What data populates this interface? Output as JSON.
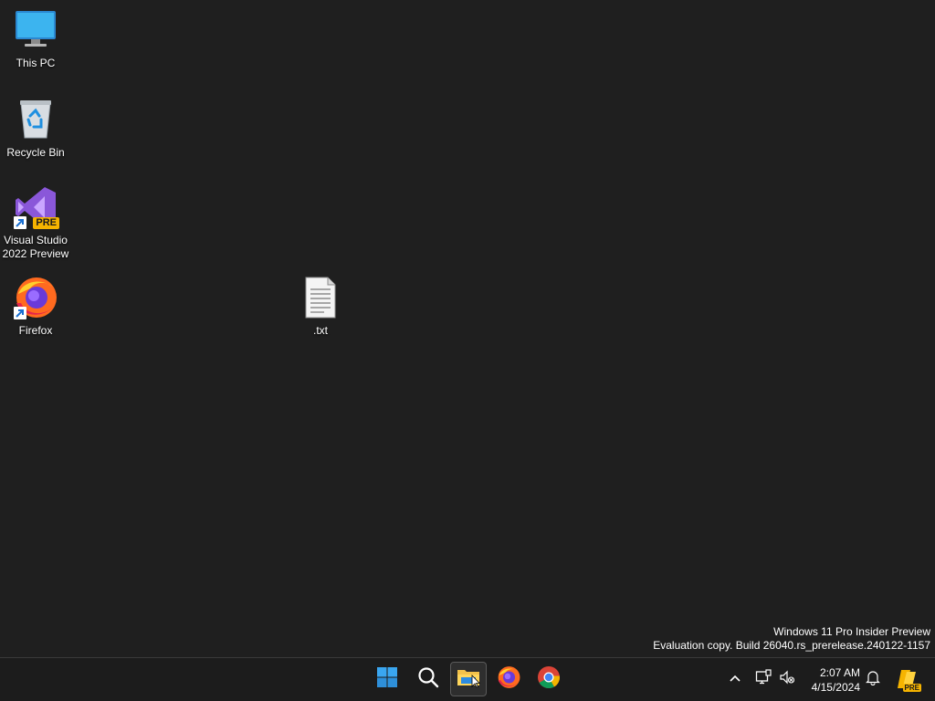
{
  "desktop": {
    "icons": [
      {
        "label": "This PC",
        "icon": "monitor-icon"
      },
      {
        "label": "Recycle Bin",
        "icon": "recycle-bin-icon"
      },
      {
        "label_line1": "Visual Studio",
        "label_line2": "2022 Preview",
        "icon": "visual-studio-icon",
        "badge": "PRE"
      },
      {
        "label": "Firefox",
        "icon": "firefox-icon"
      },
      {
        "label": ".txt",
        "icon": "text-file-icon"
      }
    ]
  },
  "watermark": {
    "line1": "Windows 11 Pro Insider Preview",
    "line2": "Evaluation copy. Build 26040.rs_prerelease.240122-1157"
  },
  "taskbar": {
    "apps": [
      "start-icon",
      "search-icon",
      "file-explorer-icon",
      "firefox-icon",
      "chrome-icon"
    ],
    "active_app": "file-explorer-icon",
    "clock": {
      "time": "2:07 AM",
      "date": "4/15/2024"
    },
    "tray_badge": "PRE",
    "colors": {
      "accent": "#0078d4",
      "background": "#1c1c1c"
    }
  }
}
